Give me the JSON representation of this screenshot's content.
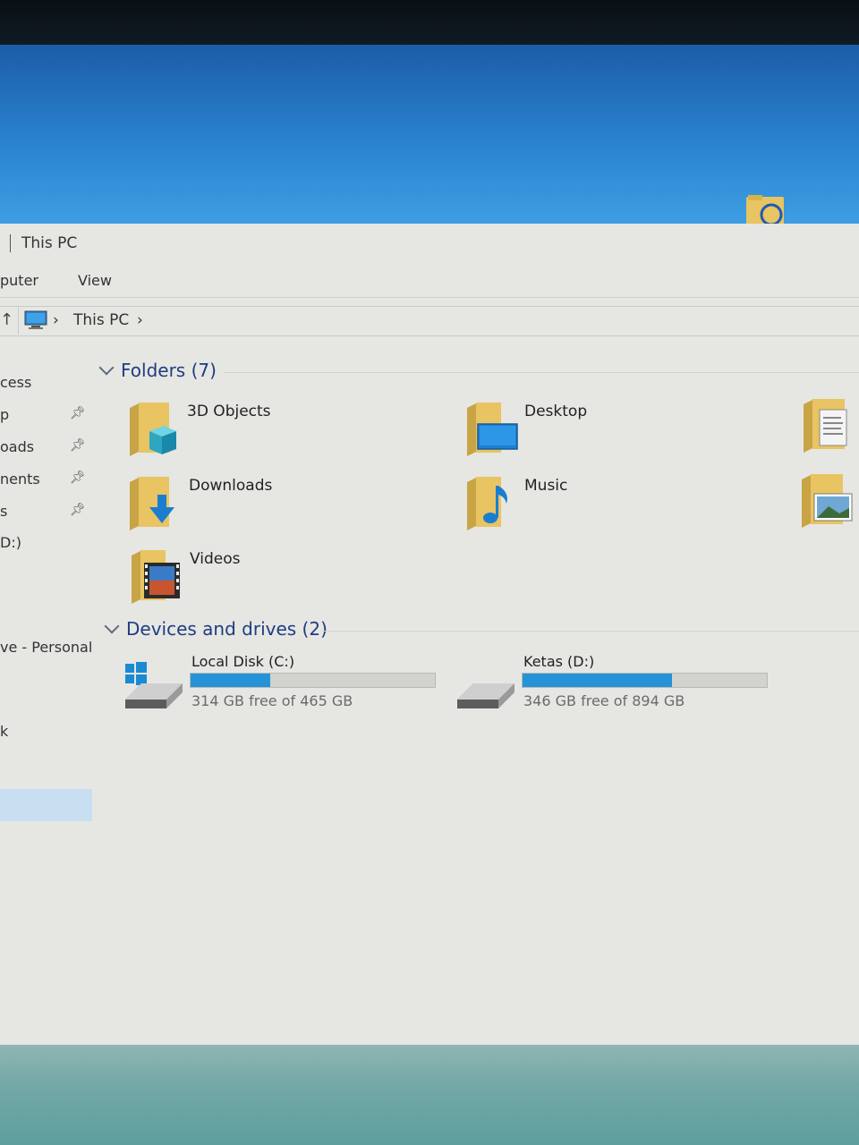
{
  "window": {
    "title": "This PC"
  },
  "ribbon": {
    "tabs": [
      "puter",
      "View"
    ]
  },
  "address": {
    "crumbs": [
      "This PC"
    ]
  },
  "nav": {
    "items": [
      {
        "label": "cess",
        "pinned": false
      },
      {
        "label": "p",
        "pinned": true
      },
      {
        "label": "oads",
        "pinned": true
      },
      {
        "label": "nents",
        "pinned": true
      },
      {
        "label": "s",
        "pinned": true
      },
      {
        "label": "D:)",
        "pinned": false
      },
      {
        "label": "ve - Personal",
        "pinned": false
      },
      {
        "label": "k",
        "pinned": false
      }
    ]
  },
  "folders": {
    "header": "Folders (7)",
    "items": [
      {
        "label": "3D Objects",
        "icon": "3d-objects-folder-icon"
      },
      {
        "label": "Desktop",
        "icon": "desktop-folder-icon"
      },
      {
        "label": "Downloads",
        "icon": "downloads-folder-icon"
      },
      {
        "label": "Music",
        "icon": "music-folder-icon"
      },
      {
        "label": "Videos",
        "icon": "videos-folder-icon"
      }
    ]
  },
  "devices": {
    "header": "Devices and drives (2)",
    "drives": [
      {
        "name": "Local Disk (C:)",
        "free": "314 GB free of 465 GB",
        "used_fraction": 0.325
      },
      {
        "name": "Ketas (D:)",
        "free": "346 GB free of 894 GB",
        "used_fraction": 0.613
      }
    ]
  },
  "colors": {
    "accent": "#2693d6",
    "header": "#1f3d80",
    "folder": "#e8c462"
  }
}
